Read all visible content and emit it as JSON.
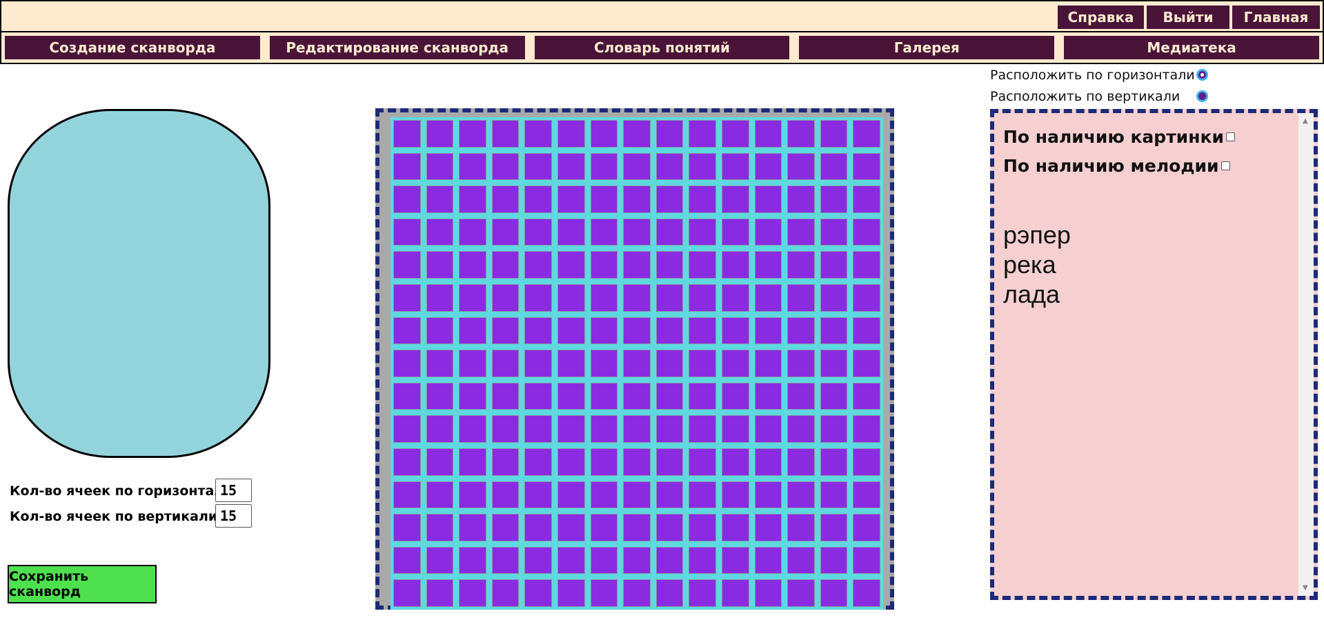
{
  "top_buttons": [
    "Справка",
    "Выйти",
    "Главная"
  ],
  "nav": [
    "Создание сканворда",
    "Редактирование сканворда",
    "Словарь понятий",
    "Галерея",
    "Медиатека"
  ],
  "orientation": {
    "horizontal_label": "Расположить по горизонтали",
    "vertical_label": "Расположить по вертикали",
    "selected": "horizontal"
  },
  "cells": {
    "horizontal_label": "Кол-во ячеек по горизонтали:",
    "vertical_label": "Кол-во ячеек по вертикали:",
    "horizontal_value": "15",
    "vertical_value": "15"
  },
  "save_label": "Сохранить сканворд",
  "grid": {
    "columns": 15,
    "rows": 15
  },
  "filters": {
    "picture_label": "По наличию картинки",
    "melody_label": "По наличию мелодии"
  },
  "words": [
    "рэпер",
    "река",
    "лада"
  ],
  "colors": {
    "dark": "#4a1438",
    "cream": "#fdebd0",
    "cell": "#8a2be2",
    "cell_border": "#5fd9e0",
    "preview": "#93d4dc",
    "panel": "#f6d0d0",
    "save": "#4fe04f",
    "dash": "#1e2a78"
  },
  "icons": {
    "scroll_up": "▲",
    "scroll_down": "▼"
  }
}
